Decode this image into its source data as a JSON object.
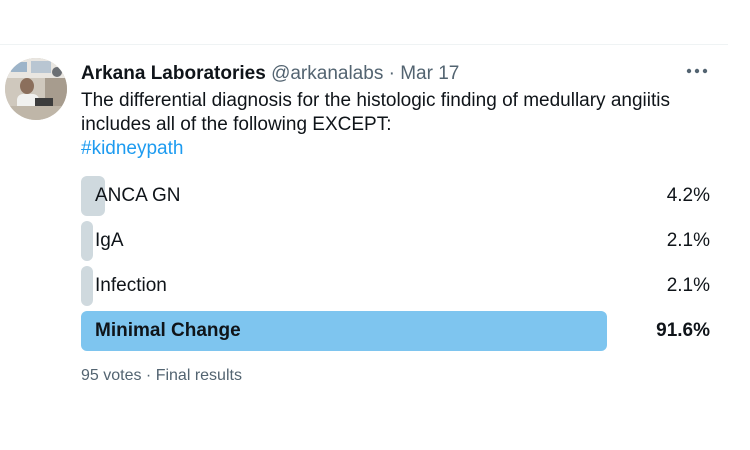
{
  "tweet": {
    "author_name": "Arkana Laboratories",
    "handle": "@arkanalabs",
    "separator": " · ",
    "date": "Mar 17",
    "text": "The differential diagnosis for the histologic finding of medullary angiitis includes all of the following EXCEPT:",
    "hashtag": "#kidneypath"
  },
  "poll": {
    "options": [
      {
        "label": "ANCA GN",
        "percent_text": "4.2%",
        "percent": 4.2,
        "winner": false
      },
      {
        "label": "IgA",
        "percent_text": "2.1%",
        "percent": 2.1,
        "winner": false
      },
      {
        "label": "Infection",
        "percent_text": "2.1%",
        "percent": 2.1,
        "winner": false
      },
      {
        "label": "Minimal Change",
        "percent_text": "91.6%",
        "percent": 91.6,
        "winner": true
      }
    ],
    "votes": "95 votes",
    "separator": " · ",
    "status": "Final results"
  },
  "colors": {
    "winner_bar": "#7ec5ef",
    "other_bar": "#cfd9de",
    "hashtag": "#1d9bf0",
    "muted_text": "#536471"
  },
  "icons": {
    "avatar": "avatar-photo",
    "more": "more-horizontal-icon"
  }
}
